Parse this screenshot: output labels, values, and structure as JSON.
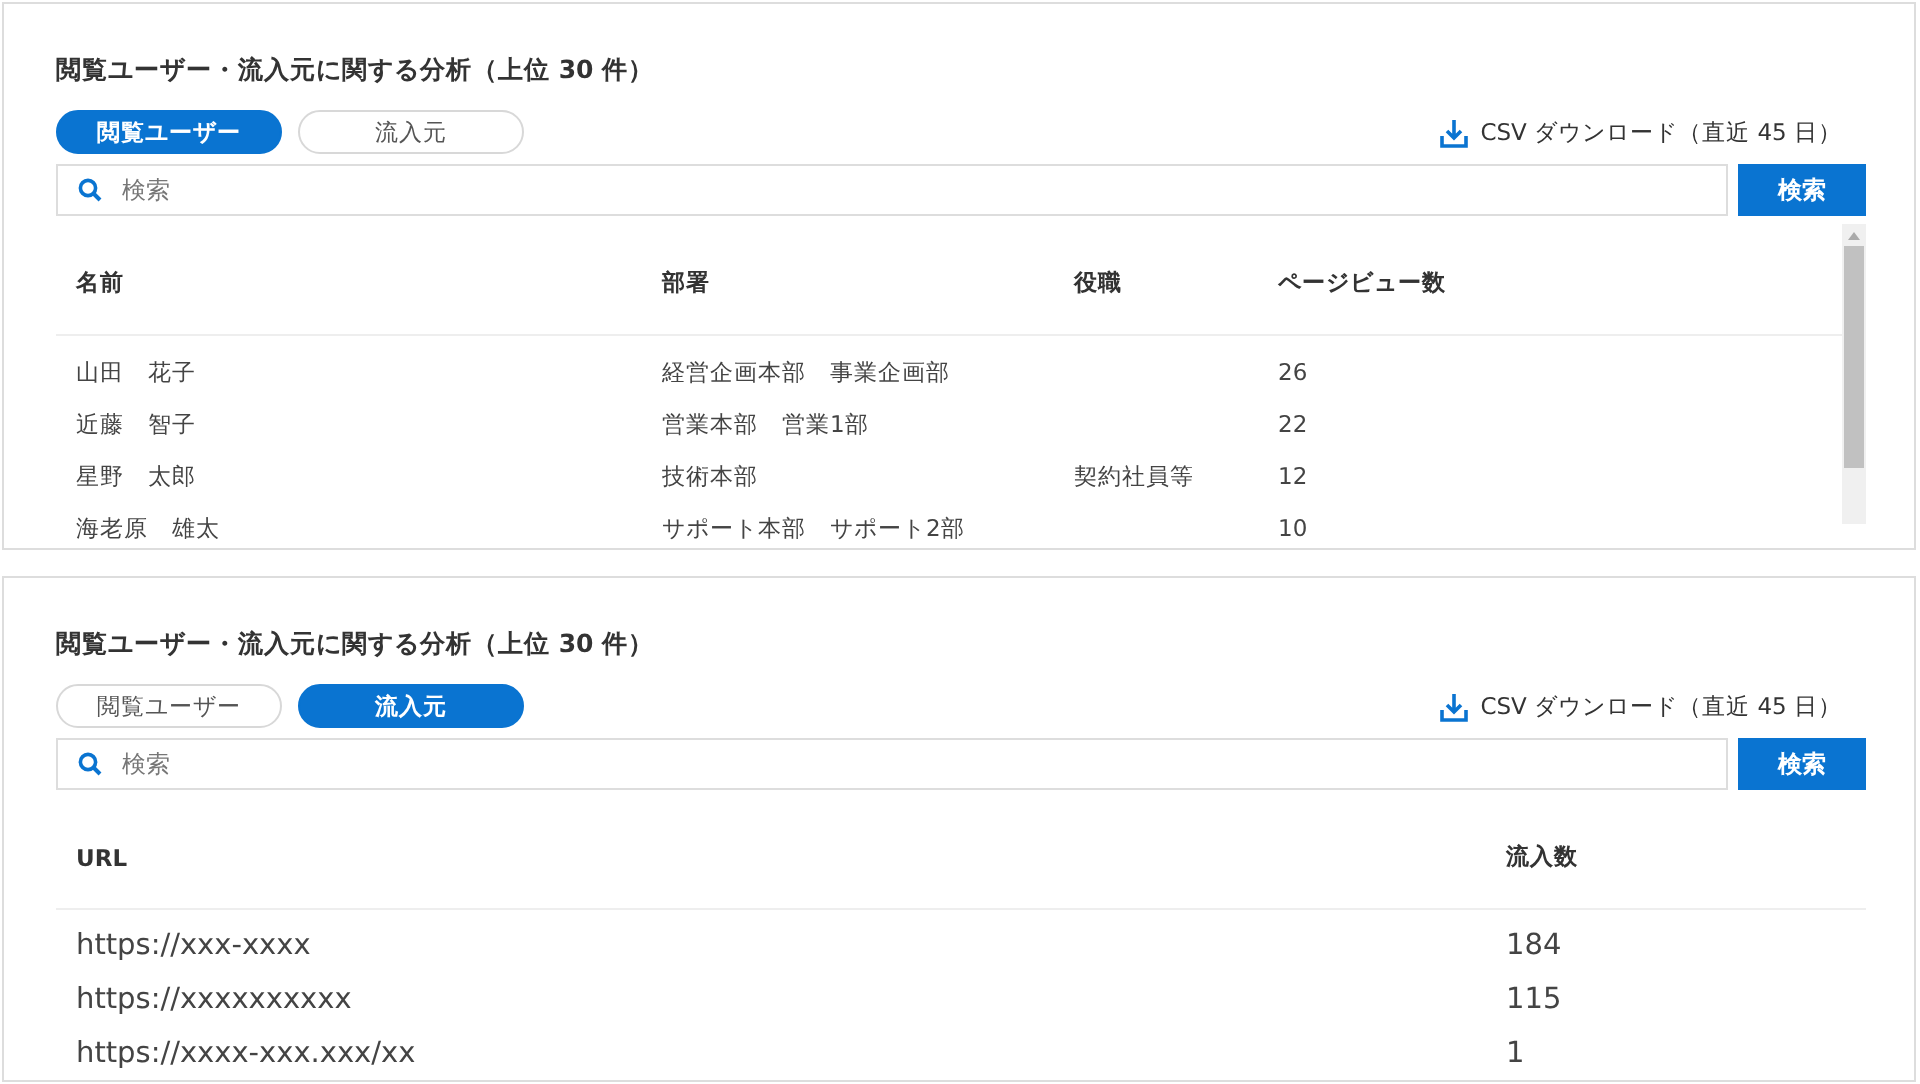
{
  "panels": [
    {
      "title": "閲覧ユーザー・流入元に関する分析（上位 30 件）",
      "tabs": [
        {
          "label": "閲覧ユーザー",
          "selected": true
        },
        {
          "label": "流入元",
          "selected": false
        }
      ],
      "csv_link": "CSV ダウンロード（直近 45 日）",
      "search": {
        "placeholder": "検索"
      },
      "search_button": "検索",
      "scrollable": true,
      "table": {
        "kind": "users",
        "columns": [
          "名前",
          "部署",
          "役職",
          "ページビュー数"
        ],
        "rows": [
          [
            "山田　花子",
            "経営企画本部　事業企画部",
            "",
            "26"
          ],
          [
            "近藤　智子",
            "営業本部　営業1部",
            "",
            "22"
          ],
          [
            "星野　太郎",
            "技術本部",
            "契約社員等",
            "12"
          ],
          [
            "海老原　雄太",
            "サポート本部　サポート2部",
            "",
            "10"
          ]
        ]
      }
    },
    {
      "title": "閲覧ユーザー・流入元に関する分析（上位 30 件）",
      "tabs": [
        {
          "label": "閲覧ユーザー",
          "selected": false
        },
        {
          "label": "流入元",
          "selected": true
        }
      ],
      "csv_link": "CSV ダウンロード（直近 45 日）",
      "search": {
        "placeholder": "検索"
      },
      "search_button": "検索",
      "scrollable": false,
      "table": {
        "kind": "sources",
        "columns": [
          "URL",
          "流入数"
        ],
        "rows": [
          [
            "https://xxx-xxxx",
            "184"
          ],
          [
            "https://xxxxxxxxxx",
            "115"
          ],
          [
            "https://xxxx-xxx.xxx/xx",
            "1"
          ]
        ]
      }
    }
  ]
}
